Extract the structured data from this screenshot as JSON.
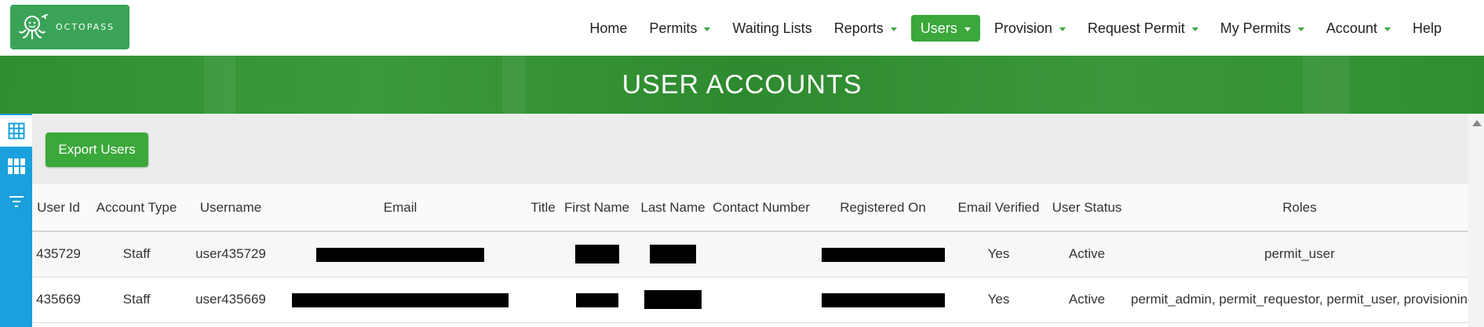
{
  "brand": {
    "logo_text": "OCTOPASS",
    "logo_color": "#3aa357"
  },
  "nav": {
    "items": [
      {
        "label": "Home",
        "has_caret": false,
        "active": false
      },
      {
        "label": "Permits",
        "has_caret": true,
        "active": false
      },
      {
        "label": "Waiting Lists",
        "has_caret": false,
        "active": false
      },
      {
        "label": "Reports",
        "has_caret": true,
        "active": false
      },
      {
        "label": "Users",
        "has_caret": true,
        "active": true
      },
      {
        "label": "Provision",
        "has_caret": true,
        "active": false
      },
      {
        "label": "Request Permit",
        "has_caret": true,
        "active": false
      },
      {
        "label": "My Permits",
        "has_caret": true,
        "active": false
      },
      {
        "label": "Account",
        "has_caret": true,
        "active": false
      },
      {
        "label": "Help",
        "has_caret": false,
        "active": false
      }
    ]
  },
  "banner": {
    "title": "USER ACCOUNTS"
  },
  "side_tools": [
    {
      "icon": "grid-table-icon",
      "selected": true
    },
    {
      "icon": "tiles-icon",
      "selected": false
    },
    {
      "icon": "filter-icon",
      "selected": false
    }
  ],
  "actions": {
    "export_label": "Export Users"
  },
  "table": {
    "columns": [
      "User Id",
      "Account Type",
      "Username",
      "Email",
      "Title",
      "First Name",
      "Last Name",
      "Contact Number",
      "Registered On",
      "Email Verified",
      "User Status",
      "Roles"
    ],
    "rows": [
      {
        "user_id": "435729",
        "account_type": "Staff",
        "username": "user435729",
        "email": "[redacted]",
        "title": "",
        "first_name": "[redacted]",
        "last_name": "[redacted]",
        "contact_number": "",
        "registered_on": "[redacted]",
        "email_verified": "Yes",
        "user_status": "Active",
        "roles": "permit_user"
      },
      {
        "user_id": "435669",
        "account_type": "Staff",
        "username": "user435669",
        "email": "[redacted]",
        "title": "",
        "first_name": "[redacted]",
        "last_name": "[redacted]",
        "contact_number": "",
        "registered_on": "[redacted]",
        "email_verified": "Yes",
        "user_status": "Active",
        "roles": "permit_admin, permit_requestor, permit_user, provisioning"
      }
    ]
  },
  "colors": {
    "accent_green": "#3aa83a",
    "banner_green": "#2f8f2f",
    "side_toolbar_blue": "#1aa0dc"
  }
}
